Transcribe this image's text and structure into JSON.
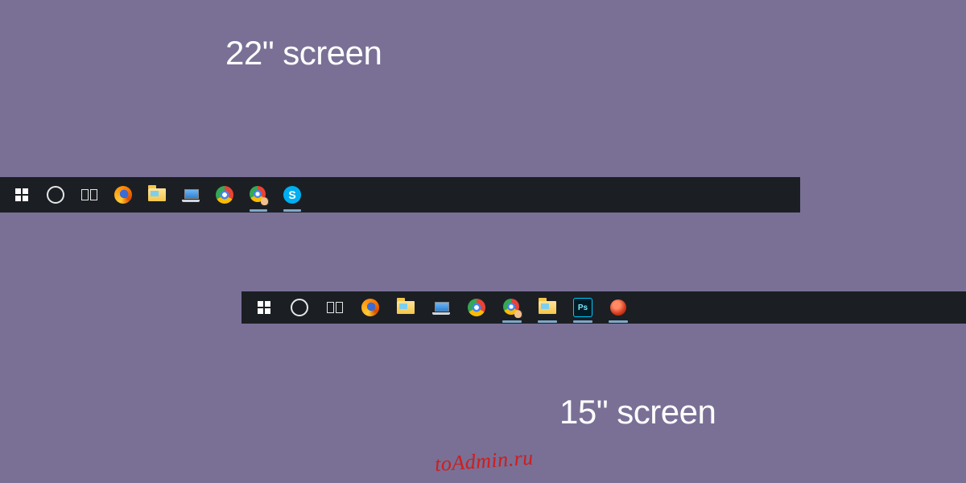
{
  "labels": {
    "top": "22\" screen",
    "bottom": "15\" screen"
  },
  "watermark": "toAdmin.ru",
  "taskbars": {
    "large": {
      "items": [
        {
          "name": "start-button",
          "icon": "windows-icon",
          "active": false
        },
        {
          "name": "cortana-button",
          "icon": "cortana-icon",
          "active": false
        },
        {
          "name": "task-view-button",
          "icon": "taskview-icon",
          "active": false
        },
        {
          "name": "firefox-app",
          "icon": "firefox-icon",
          "active": false
        },
        {
          "name": "file-explorer-app",
          "icon": "folder-icon",
          "active": false
        },
        {
          "name": "this-pc-app",
          "icon": "laptop-icon",
          "active": false
        },
        {
          "name": "chrome-app",
          "icon": "chrome-icon",
          "active": false
        },
        {
          "name": "chrome-app-running",
          "icon": "chrome-hand-icon",
          "active": true
        },
        {
          "name": "skype-app",
          "icon": "skype-icon",
          "active": true
        }
      ]
    },
    "small": {
      "items": [
        {
          "name": "start-button",
          "icon": "windows-icon",
          "active": false
        },
        {
          "name": "cortana-button",
          "icon": "cortana-icon",
          "active": false
        },
        {
          "name": "task-view-button",
          "icon": "taskview-icon",
          "active": false
        },
        {
          "name": "firefox-app",
          "icon": "firefox-icon",
          "active": false
        },
        {
          "name": "file-explorer-app",
          "icon": "folder-icon",
          "active": false
        },
        {
          "name": "this-pc-app",
          "icon": "laptop-icon",
          "active": false
        },
        {
          "name": "chrome-app",
          "icon": "chrome-icon",
          "active": false
        },
        {
          "name": "chrome-app-running",
          "icon": "chrome-hand-icon",
          "active": true
        },
        {
          "name": "file-explorer-running",
          "icon": "folder-icon",
          "active": true
        },
        {
          "name": "photoshop-app",
          "icon": "photoshop-icon",
          "active": true
        },
        {
          "name": "adobe-app",
          "icon": "red-icon",
          "active": true
        }
      ]
    }
  }
}
